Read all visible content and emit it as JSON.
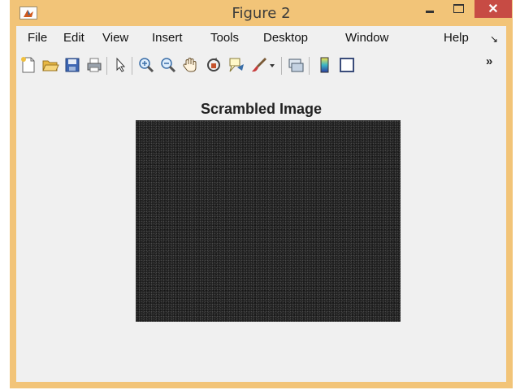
{
  "window": {
    "title": "Figure 2",
    "close_glyph": "✕",
    "app_icon": "matlab-icon"
  },
  "menu": [
    "File",
    "Edit",
    "View",
    "Insert",
    "Tools",
    "Desktop",
    "Window",
    "Help"
  ],
  "toolbar": {
    "icons": [
      "new-figure-icon",
      "open-file-icon",
      "save-icon",
      "print-icon",
      "pointer-icon",
      "zoom-in-icon",
      "zoom-out-icon",
      "pan-icon",
      "rotate-3d-icon",
      "data-cursor-icon",
      "brush-icon",
      "dropdown-icon",
      "link-plot-icon",
      "colorbar-icon",
      "legend-icon",
      "overflow-icon"
    ],
    "overflow": "»"
  },
  "figure": {
    "title": "Scrambled Image"
  },
  "colors": {
    "titlebar": "#f2c478",
    "close_button": "#c74b44",
    "canvas": "#f0f0f0",
    "image": "#202020"
  }
}
